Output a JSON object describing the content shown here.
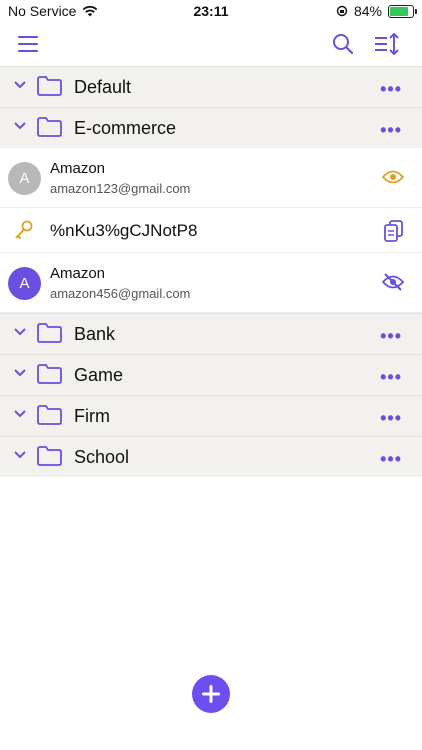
{
  "status": {
    "carrier": "No Service",
    "time": "23:11",
    "battery": "84%",
    "battery_level": 0.84
  },
  "toolbar": {
    "menu_icon": "hamburger-menu-icon",
    "search_icon": "search-icon",
    "sort_icon": "sort-icon"
  },
  "folders_top": [
    {
      "name": "Default"
    },
    {
      "name": "E-commerce"
    }
  ],
  "ecommerce_items": {
    "account1": {
      "avatar": "A",
      "title": "Amazon",
      "email": "amazon123@gmail.com"
    },
    "password": {
      "value": "%nKu3%gCJNotP8"
    },
    "account2": {
      "avatar": "A",
      "title": "Amazon",
      "email": "amazon456@gmail.com"
    }
  },
  "folders_bottom": [
    {
      "name": "Bank"
    },
    {
      "name": "Game"
    },
    {
      "name": "Firm"
    },
    {
      "name": "School"
    }
  ],
  "more_label": "•••",
  "colors": {
    "accent": "#6a4fe0",
    "eye": "#e0a020",
    "key": "#e0a020",
    "avatar_gray": "#b8b8b8",
    "avatar_purple": "#6a4fe0",
    "folder_bg": "#f2f1ee"
  }
}
